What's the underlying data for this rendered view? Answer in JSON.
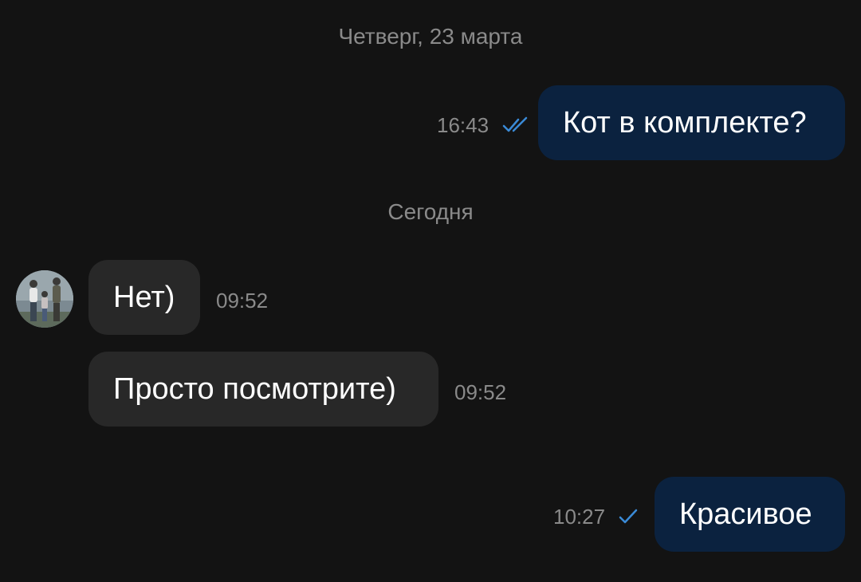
{
  "colors": {
    "background": "#131313",
    "outgoing_bubble": "#0b223f",
    "incoming_bubble": "#282828",
    "text_primary": "#ffffff",
    "text_secondary": "#8a8a8a",
    "read_check": "#3a8ad6"
  },
  "date_separators": [
    "Четверг, 23 марта",
    "Сегодня"
  ],
  "messages": [
    {
      "direction": "outgoing",
      "text": "Кот в комплекте?",
      "time": "16:43",
      "status_icon": "double-check-icon"
    },
    {
      "direction": "incoming",
      "text": "Нет)",
      "time": "09:52"
    },
    {
      "direction": "incoming",
      "text": "Просто посмотрите)",
      "time": "09:52"
    },
    {
      "direction": "outgoing",
      "text": "Красивое",
      "time": "10:27",
      "status_icon": "single-check-icon"
    }
  ],
  "avatar": {
    "icon": "contact-avatar-photo"
  }
}
